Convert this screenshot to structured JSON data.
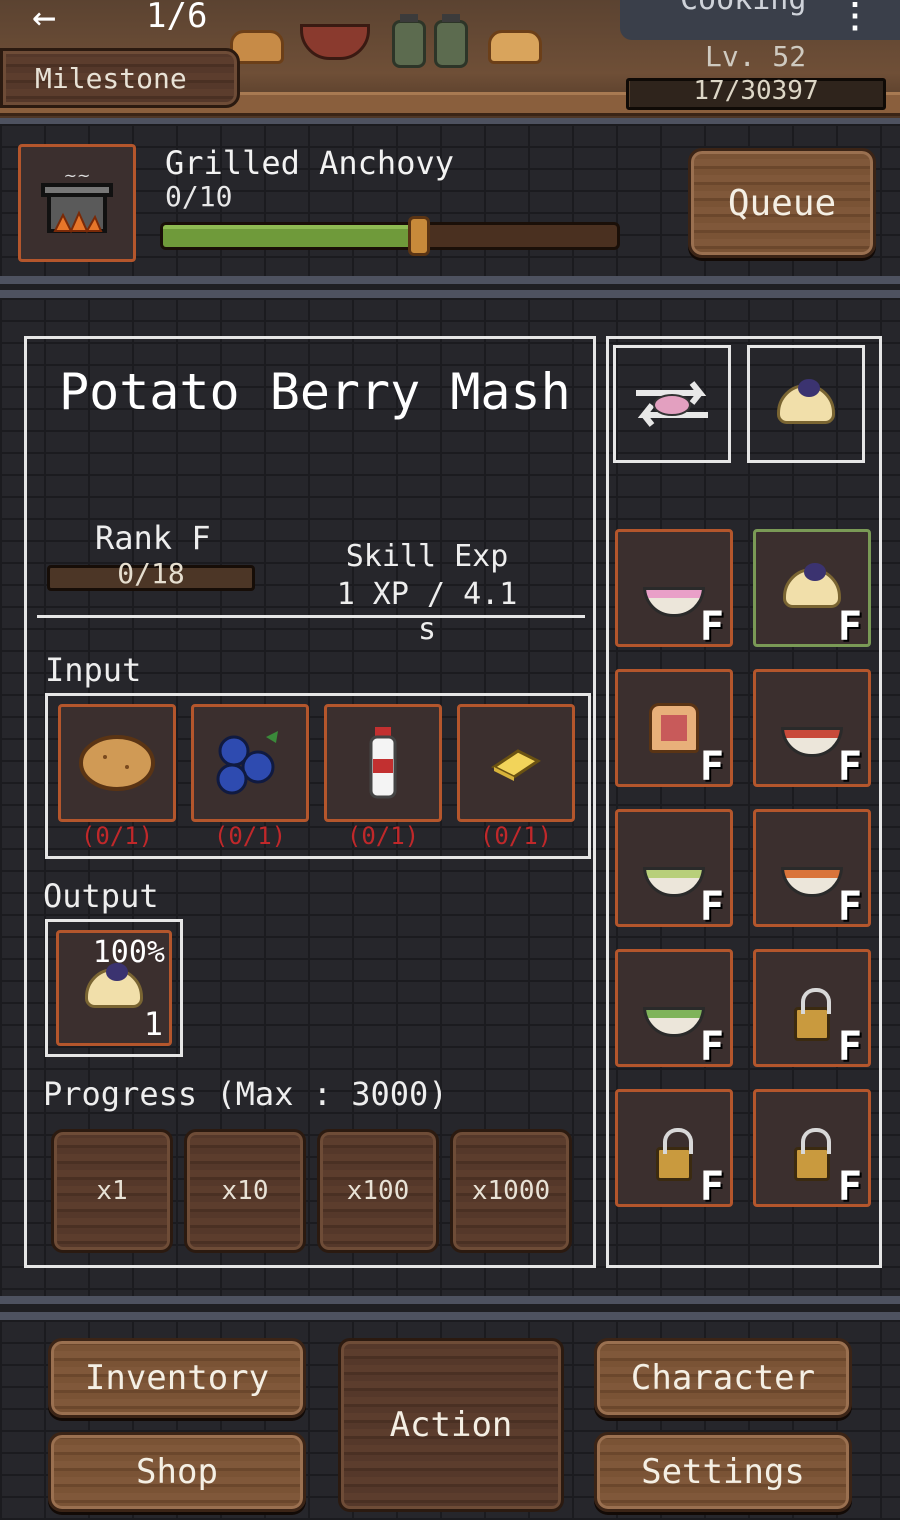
{
  "header": {
    "back_icon": "arrow-left-icon",
    "page_counter": "1/6",
    "milestone_label": "Milestone",
    "skill_title": "Cooking",
    "more_icon": "more-vertical-icon",
    "level_label": "Lv. 52",
    "xp_text": "17/30397"
  },
  "current_action": {
    "name": "Grilled Anchovy",
    "count": "0/10",
    "progress_fraction": 0.56,
    "queue_label": "Queue",
    "icon": "cooking-pot-fire-icon"
  },
  "recipe": {
    "title": "Potato Berry Mash",
    "rank_label": "Rank F",
    "rank_progress": "0/18",
    "rank_fraction": 0,
    "skill_exp_label": "Skill Exp",
    "skill_exp_value": "1 XP / 4.1 s",
    "input_label": "Input",
    "inputs": [
      {
        "name": "potato-icon",
        "req": "(0/1)"
      },
      {
        "name": "blueberries-icon",
        "req": "(0/1)"
      },
      {
        "name": "milk-bottle-icon",
        "req": "(0/1)"
      },
      {
        "name": "butter-icon",
        "req": "(0/1)"
      }
    ],
    "output_label": "Output",
    "output": {
      "chance": "100%",
      "qty": "1",
      "icon": "potato-berry-mash-icon"
    },
    "progress_label": "Progress (Max : 3000)",
    "qty_buttons": [
      "x1",
      "x10",
      "x100",
      "x1000"
    ]
  },
  "recipe_list": {
    "top": [
      "swap-icon",
      "potato-berry-mash-icon"
    ],
    "tiles": [
      {
        "icon": "berry-yogurt-bowl-icon",
        "rank": "F",
        "selected": false
      },
      {
        "icon": "potato-berry-mash-icon",
        "rank": "F",
        "selected": true
      },
      {
        "icon": "jam-toast-icon",
        "rank": "F",
        "selected": false
      },
      {
        "icon": "tomato-salad-bowl-icon",
        "rank": "F",
        "selected": false
      },
      {
        "icon": "green-salad-icon",
        "rank": "F",
        "selected": false
      },
      {
        "icon": "pasta-bowl-icon",
        "rank": "F",
        "selected": false
      },
      {
        "icon": "vegetable-bowl-icon",
        "rank": "F",
        "selected": false
      },
      {
        "icon": "locked-icon",
        "rank": "F",
        "selected": false
      },
      {
        "icon": "locked-icon",
        "rank": "F",
        "selected": false
      },
      {
        "icon": "locked-icon",
        "rank": "F",
        "selected": false
      }
    ]
  },
  "nav": {
    "inventory": "Inventory",
    "shop": "Shop",
    "action": "Action",
    "character": "Character",
    "settings": "Settings"
  }
}
